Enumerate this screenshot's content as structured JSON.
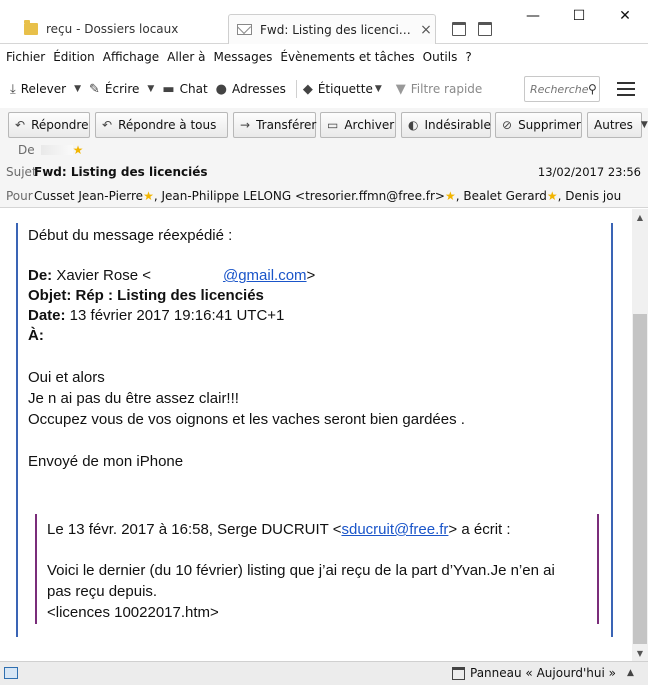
{
  "tabs": [
    {
      "label": "reçu - Dossiers locaux",
      "icon": "folder-icon"
    },
    {
      "label": "Fwd: Listing des licenciés ...",
      "icon": "envelope-icon"
    }
  ],
  "window_buttons": {
    "minimize": "—",
    "maximize": "☐",
    "close": "✕"
  },
  "menu": [
    "Fichier",
    "Édition",
    "Affichage",
    "Aller à",
    "Messages",
    "Évènements et tâches",
    "Outils",
    "?"
  ],
  "toolbar": {
    "relever": "Relever",
    "ecrire": "Écrire",
    "chat": "Chat",
    "adresses": "Adresses",
    "etiquette": "Étiquette",
    "filtre": "Filtre rapide",
    "search_placeholder": "Recherche"
  },
  "actions": {
    "repondre": "Répondre",
    "repondre_tous": "Répondre à tous",
    "transferer": "Transférer",
    "archiver": "Archiver",
    "indesirable": "Indésirable",
    "supprimer": "Supprimer",
    "autres": "Autres"
  },
  "header": {
    "from_label": "De",
    "subject_label": "Sujet",
    "subject": "Fwd: Listing des licenciés",
    "date": "13/02/2017 23:56",
    "to_label": "Pour",
    "recipients": [
      "Cusset Jean-Pierre",
      ", Jean-Philippe LELONG <tresorier.ffmn@free.fr>",
      ", Bealet Gerard",
      ", Denis jou"
    ]
  },
  "message": {
    "intro": "Début du message réexpédié :",
    "from_label": "De:",
    "from_name": " Xavier Rose <",
    "from_email": "@gmail.com",
    "from_close": ">",
    "subject_label": "Objet: Rép : Listing des licenciés",
    "date_label": "Date:",
    "date_value": " 13 février 2017 19:16:41 UTC+1",
    "to_label": "À:",
    "lines": [
      "Oui et alors",
      "Je n ai pas du être assez clair!!!",
      "Occupez vous de vos oignons et les vaches seront bien gardées ."
    ],
    "signature": "Envoyé de mon iPhone",
    "quote": {
      "attribution_start": "Le 13 févr. 2017 à 16:58, Serge DUCRUIT <",
      "attribution_email": "sducruit@free.fr",
      "attribution_end": "> a écrit :",
      "line1": "Voici le dernier (du 10 février) listing que j’ai reçu de la part d’Yvan.Je n’en ai",
      "line2": "pas reçu depuis.",
      "line3": "<licences 10022017.htm>"
    }
  },
  "status": {
    "panel": "Panneau « Aujourd'hui »"
  }
}
